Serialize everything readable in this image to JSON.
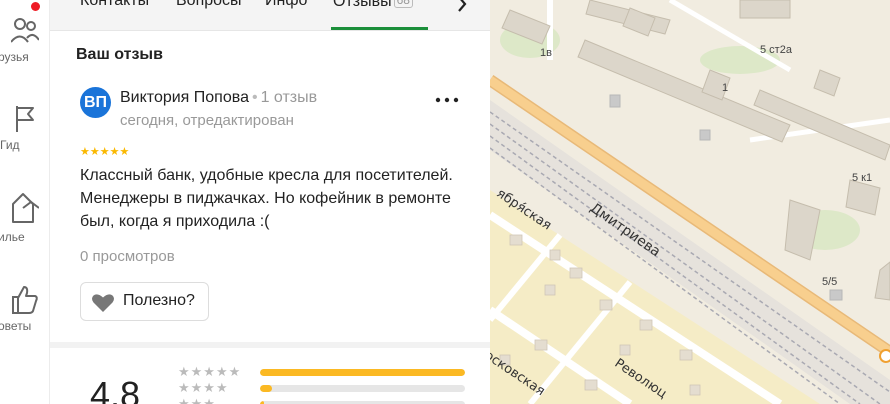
{
  "nav": {
    "items": [
      {
        "label": "рузья",
        "icon": "friends-icon"
      },
      {
        "label": "Гид",
        "icon": "flag-icon"
      },
      {
        "label": "илье",
        "icon": "housing-icon"
      },
      {
        "label": "оветы",
        "icon": "thumbs-up-icon"
      }
    ]
  },
  "tabs": {
    "items": [
      {
        "label": "Контакты"
      },
      {
        "label": "Вопросы"
      },
      {
        "label": "Инфо"
      },
      {
        "label": "Отзывы",
        "count": "68",
        "active": true
      }
    ]
  },
  "review_section": {
    "title": "Ваш отзыв",
    "author": {
      "initials": "ВП",
      "name": "Виктория Попова",
      "reviews_count": "1 отзыв",
      "meta": "сегодня, отредактирован"
    },
    "stars": "★★★★★",
    "rating": 5,
    "text": "Классный банк, удобные кресла для посетителей. Менеджеры в пиджачках. Но кофейник в ремонте был, когда я приходила :(",
    "views": "0 просмотров",
    "helpful_label": "Полезно?"
  },
  "rating_summary": {
    "value": "4,8",
    "distribution": [
      {
        "stars": 5,
        "glyphs": "★★★★★",
        "fraction": 1.0
      },
      {
        "stars": 4,
        "glyphs": "★★★★",
        "fraction": 0.06
      },
      {
        "stars": 3,
        "glyphs": "★★★",
        "fraction": 0.02
      }
    ]
  },
  "map": {
    "street_labels": [
      "Дмитриева",
      "ября́ская",
      "Революц",
      "осковская"
    ],
    "building_labels": [
      "1в",
      "5 ст2а",
      "5 к1",
      "5/5",
      "1"
    ]
  },
  "colors": {
    "accent_tab": "#1b8f3a",
    "avatar": "#1a74d9",
    "star": "#fab800",
    "bar_fill": "#fbb923",
    "notification": "#ee1c25",
    "road": "#f6c27a"
  }
}
